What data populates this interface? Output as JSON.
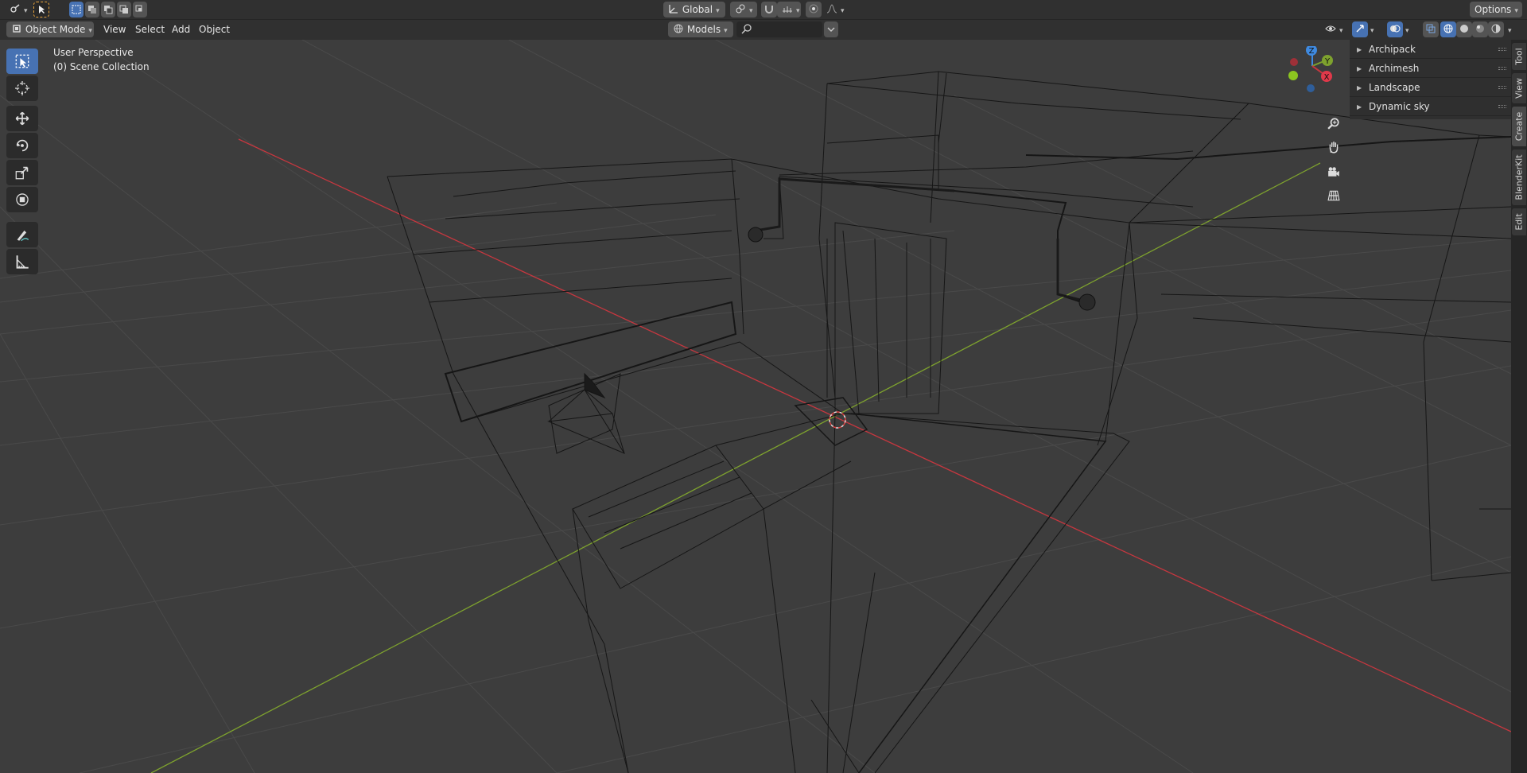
{
  "header": {
    "transform_orientation": "Global",
    "options_label": "Options"
  },
  "viewport_header": {
    "mode": "Object Mode",
    "menus": [
      "View",
      "Select",
      "Add",
      "Object"
    ],
    "collection_filter": "Models",
    "search_placeholder": ""
  },
  "overlay": {
    "perspective": "User Perspective",
    "collection": "(0) Scene Collection"
  },
  "gizmo": {
    "z_label": "Z",
    "y_label": "Y",
    "x_label": "X"
  },
  "sidebar": {
    "panels": [
      "Archipack",
      "Archimesh",
      "Landscape",
      "Dynamic sky"
    ],
    "tabs": [
      "Tool",
      "View",
      "Create",
      "BlenderKit",
      "Edit"
    ],
    "active_tab": "Create"
  },
  "tools": [
    {
      "icon": "select-box-icon",
      "active": true
    },
    {
      "icon": "cursor-icon",
      "active": false
    },
    {
      "icon": "move-icon",
      "active": false
    },
    {
      "icon": "rotate-icon",
      "active": false
    },
    {
      "icon": "scale-icon",
      "active": false
    },
    {
      "icon": "transform-icon",
      "active": false
    },
    {
      "icon": "annotate-icon",
      "active": false
    },
    {
      "icon": "measure-icon",
      "active": false
    }
  ],
  "colors": {
    "axis_x": "#c6373f",
    "axis_y": "#7ea22e",
    "accent": "#4772b3"
  }
}
